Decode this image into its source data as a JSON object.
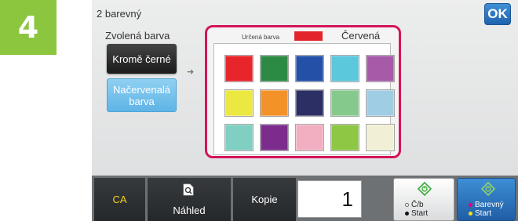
{
  "step": "4",
  "screen": {
    "title": "2 barevný",
    "ok_label": "OK",
    "selected_color_label": "Zvolená barva",
    "options": [
      {
        "label": "Kromě černé",
        "selected": false
      },
      {
        "label": "Načervenalá barva",
        "selected": true
      }
    ]
  },
  "palette": {
    "label": "Určená barva",
    "current_swatch_color": "#e2252b",
    "current_color_name": "Červená",
    "swatches": [
      "#e8252b",
      "#2d8a45",
      "#2450a8",
      "#5cc8dc",
      "#a65aa8",
      "#ece842",
      "#f39228",
      "#2b2f63",
      "#86c98c",
      "#9fcde3",
      "#7fcfc3",
      "#7b2c8c",
      "#f2afc2",
      "#8ec744",
      "#f1f0d6"
    ]
  },
  "bottom_bar": {
    "ca_label": "CA",
    "preview_label": "Náhled",
    "copies_label": "Kopie",
    "copies_value": "1",
    "start_bw_label1": "Č/b",
    "start_bw_label2": "Start",
    "start_color_label1": "Barevný",
    "start_color_label2": "Start"
  }
}
